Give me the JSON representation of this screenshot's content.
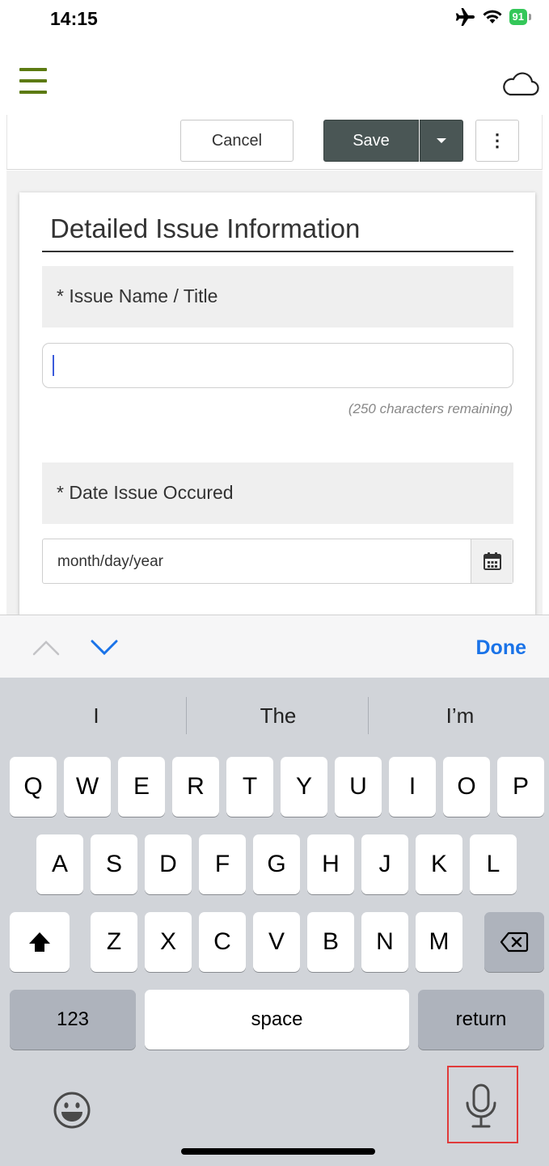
{
  "status_bar": {
    "time": "14:15",
    "battery": "91"
  },
  "toolbar": {
    "cancel_label": "Cancel",
    "save_label": "Save",
    "more_label": "⋮"
  },
  "form": {
    "section_title": "Detailed Issue Information",
    "issue_name_label": "* Issue Name / Title",
    "issue_name_value": "",
    "char_remaining": "(250 characters remaining)",
    "date_label": "* Date Issue Occured",
    "date_placeholder": "month/day/year"
  },
  "accessory": {
    "done_label": "Done"
  },
  "keyboard": {
    "suggestions": [
      "I",
      "The",
      "I’m"
    ],
    "row1": [
      "Q",
      "W",
      "E",
      "R",
      "T",
      "Y",
      "U",
      "I",
      "O",
      "P"
    ],
    "row2": [
      "A",
      "S",
      "D",
      "F",
      "G",
      "H",
      "J",
      "K",
      "L"
    ],
    "row3": [
      "Z",
      "X",
      "C",
      "V",
      "B",
      "N",
      "M"
    ],
    "numbers_label": "123",
    "space_label": "space",
    "return_label": "return"
  },
  "colors": {
    "menu_accent": "#5c7a11",
    "save_button": "#4a5655",
    "done_blue": "#1a73e8",
    "highlight_red": "#e03a3a"
  },
  "icons": {
    "menu": "hamburger-menu-icon",
    "cloud": "cloud-icon",
    "calendar": "calendar-icon",
    "emoji": "emoji-icon",
    "mic": "microphone-icon",
    "shift": "shift-icon",
    "backspace": "backspace-icon"
  }
}
